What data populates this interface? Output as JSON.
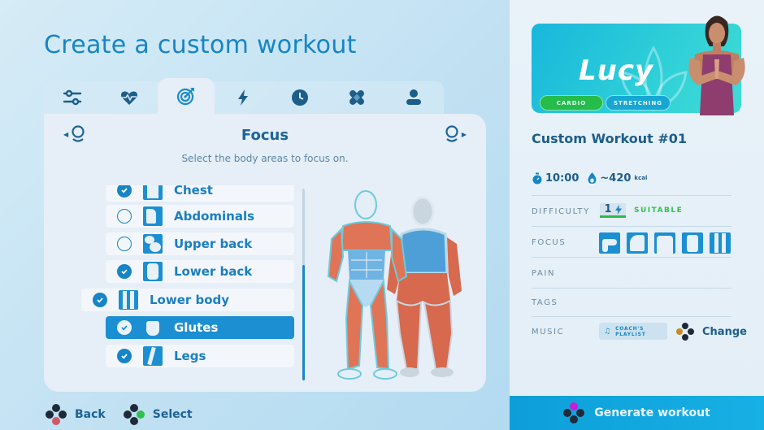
{
  "page": {
    "title": "Create a custom workout"
  },
  "tabs": [
    {
      "id": "settings",
      "icon": "sliders-icon",
      "active": false
    },
    {
      "id": "heart-rate",
      "icon": "heart-pulse-icon",
      "active": false
    },
    {
      "id": "focus",
      "icon": "target-icon",
      "active": true
    },
    {
      "id": "intensity",
      "icon": "lightning-icon",
      "active": false
    },
    {
      "id": "duration",
      "icon": "clock-icon",
      "active": false
    },
    {
      "id": "pain",
      "icon": "bandage-icon",
      "active": false
    },
    {
      "id": "coach",
      "icon": "person-icon",
      "active": false
    }
  ],
  "focus_panel": {
    "title": "Focus",
    "subtitle": "Select the body areas to focus on.",
    "items": [
      {
        "label": "Chest",
        "checked": true,
        "level": "sub",
        "selected": false
      },
      {
        "label": "Abdominals",
        "checked": false,
        "level": "sub",
        "selected": false
      },
      {
        "label": "Upper back",
        "checked": false,
        "level": "sub",
        "selected": false
      },
      {
        "label": "Lower back",
        "checked": true,
        "level": "sub",
        "selected": false
      },
      {
        "label": "Lower body",
        "checked": true,
        "level": "parent",
        "selected": false
      },
      {
        "label": "Glutes",
        "checked": true,
        "level": "sub",
        "selected": true
      },
      {
        "label": "Legs",
        "checked": true,
        "level": "sub",
        "selected": false
      }
    ],
    "scroll_position": 0.4
  },
  "hints": {
    "back": "Back",
    "select": "Select"
  },
  "summary": {
    "coach_name": "Lucy",
    "tags": [
      "CARDIO",
      "STRETCHING"
    ],
    "workout_title": "Custom Workout #01",
    "duration": "10:00",
    "calories": "~420",
    "calories_unit": "kcal",
    "difficulty_label": "DIFFICULTY",
    "difficulty_value": "1",
    "difficulty_text": "SUITABLE",
    "focus_label": "FOCUS",
    "pain_label": "PAIN",
    "tags_label": "TAGS",
    "music_label": "MUSIC",
    "music_line1": "COACH'S",
    "music_line2": "PLAYLIST",
    "change_label": "Change",
    "generate_label": "Generate workout"
  },
  "colors": {
    "accent": "#1685c6",
    "selected_row": "#1b8fd2",
    "muscle_selected": "#e07457",
    "muscle_unselected": "#5ea7dc",
    "suitable": "#2cc54c",
    "cardio_chip": "#25bc4a",
    "stretch_chip": "#17a7d3"
  }
}
